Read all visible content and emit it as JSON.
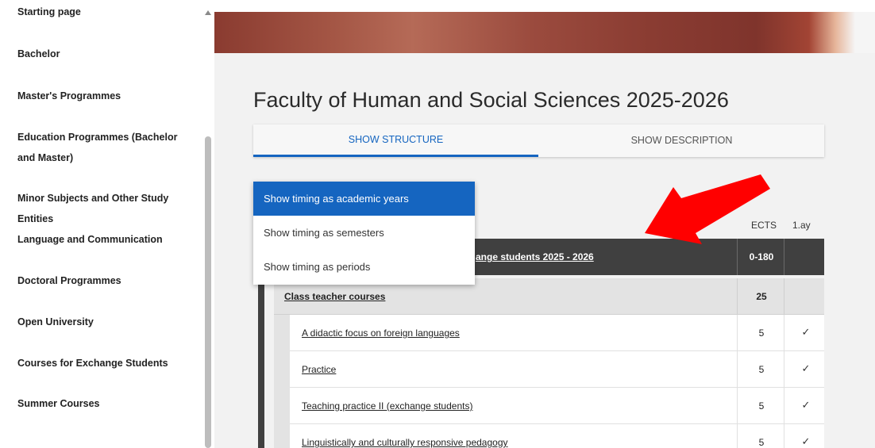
{
  "sidebar": {
    "items": [
      {
        "label": "Starting page"
      },
      {
        "label": "Bachelor"
      },
      {
        "label": "Master's Programmes"
      },
      {
        "label": "Education Programmes (Bachelor and Master)"
      },
      {
        "label": "Minor Subjects and Other Study Entities"
      },
      {
        "label": "Language and Communication"
      },
      {
        "label": "Doctoral Programmes"
      },
      {
        "label": "Open University"
      },
      {
        "label": "Courses for Exchange Students"
      },
      {
        "label": "Summer Courses"
      }
    ]
  },
  "main": {
    "title": "Faculty of Human and Social Sciences 2025-2026",
    "tabs": [
      {
        "label": "SHOW STRUCTURE",
        "active": true
      },
      {
        "label": "SHOW DESCRIPTION",
        "active": false
      }
    ],
    "timing_dropdown": {
      "options": [
        {
          "label": "Show timing as academic years",
          "selected": true
        },
        {
          "label": "Show timing as semesters",
          "selected": false
        },
        {
          "label": "Show timing as periods",
          "selected": false
        }
      ]
    },
    "table": {
      "headers": {
        "ects": "ECTS",
        "year": "1.ay"
      },
      "root": {
        "title_visible": "ange students 2025 - 2026",
        "ects": "0-180"
      },
      "group": {
        "title": "Class teacher courses",
        "ects": "25"
      },
      "courses": [
        {
          "title": "A didactic focus on foreign languages",
          "ects": "5",
          "check": "✓"
        },
        {
          "title": "Practice",
          "ects": "5",
          "check": "✓"
        },
        {
          "title": "Teaching practice II (exchange students)",
          "ects": "5",
          "check": "✓"
        },
        {
          "title": "Linguistically and culturally responsive pedagogy",
          "ects": "5",
          "check": "✓"
        }
      ]
    }
  },
  "colors": {
    "accent": "#1565c0",
    "dark_row": "#404040",
    "arrow": "#ff0000"
  },
  "icons": {
    "scroll_up": "triangle-up",
    "check": "checkmark",
    "annotation": "red-arrow"
  }
}
